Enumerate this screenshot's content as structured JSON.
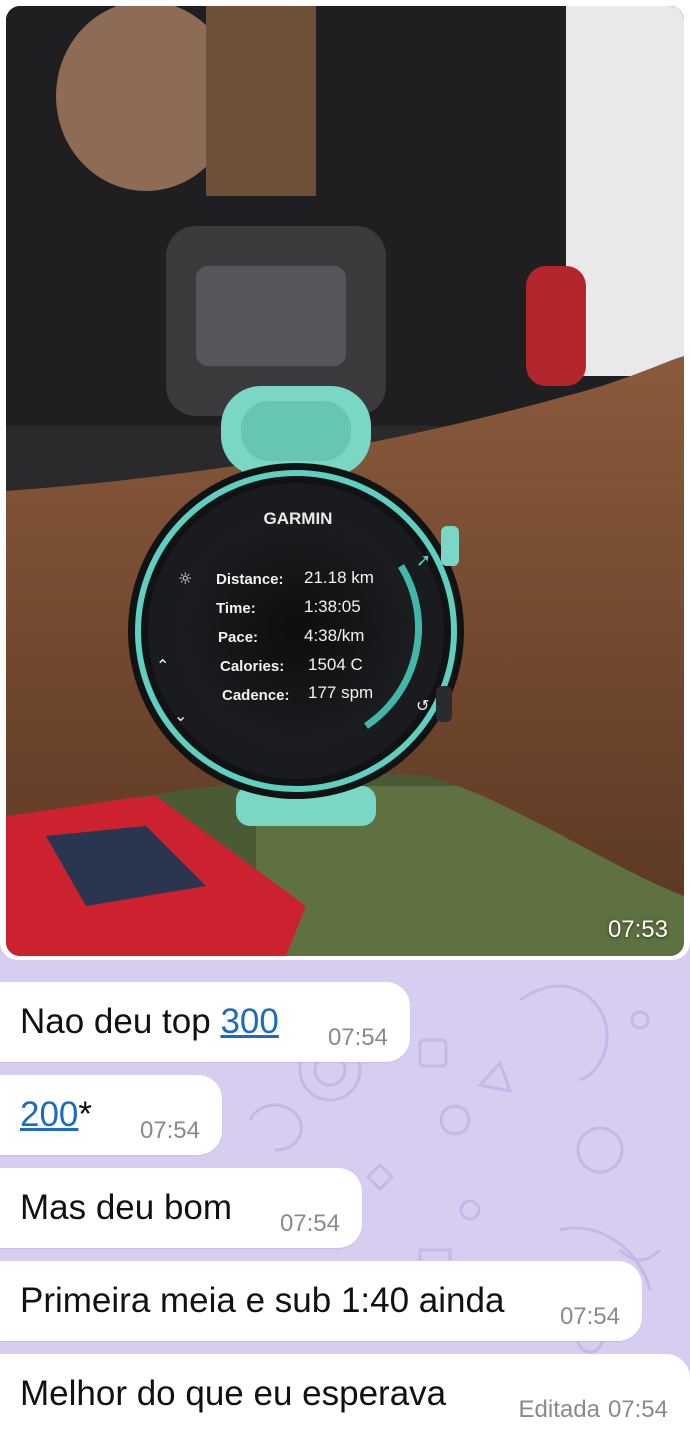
{
  "photo": {
    "watch": {
      "brand": "GARMIN",
      "rows": [
        {
          "label": "Distance:",
          "value": "21.18 km"
        },
        {
          "label": "Time:",
          "value": "1:38:05"
        },
        {
          "label": "Pace:",
          "value": "4:38/km"
        },
        {
          "label": "Calories:",
          "value": "1504 C"
        },
        {
          "label": "Cadence:",
          "value": "177 spm"
        }
      ]
    },
    "time": "07:53"
  },
  "messages": [
    {
      "text": "Nao deu top ",
      "link": "300",
      "time": "07:54"
    },
    {
      "link": "200",
      "suffix": "*",
      "time": "07:54"
    },
    {
      "text": "Mas deu bom",
      "time": "07:54"
    },
    {
      "text": "Primeira meia e sub 1:40 ainda",
      "time": "07:54"
    },
    {
      "text": "Melhor do que eu esperava",
      "edited": "Editada",
      "time": "07:54"
    }
  ]
}
